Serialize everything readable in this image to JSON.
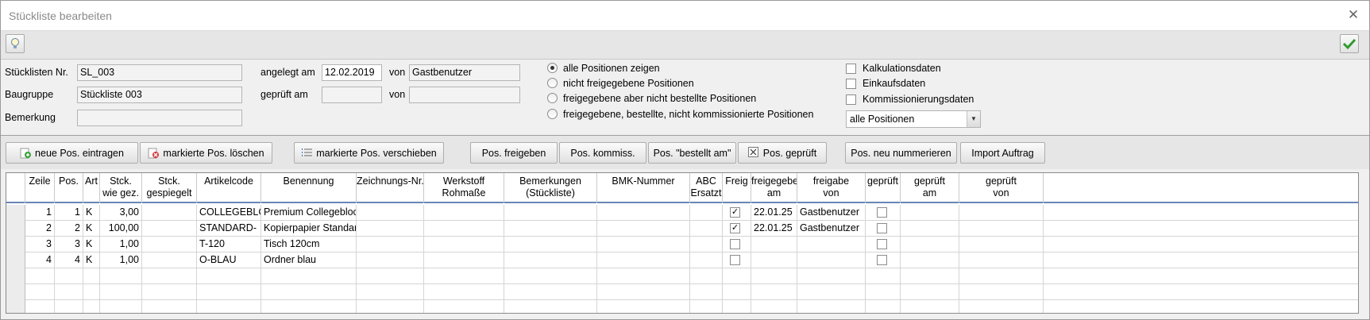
{
  "window": {
    "title": "Stückliste bearbeiten"
  },
  "header": {
    "stueckliste_label": "Stücklisten Nr.",
    "stueckliste_value": "SL_003",
    "baugruppe_label": "Baugruppe",
    "baugruppe_value": "Stückliste 003",
    "bemerkung_label": "Bemerkung",
    "bemerkung_value": "",
    "angelegt_label": "angelegt am",
    "angelegt_value": "12.02.2019",
    "von_label": "von",
    "angelegt_von_value": "Gastbenutzer",
    "geprueft_label": "geprüft am",
    "geprueft_value": "",
    "geprueft_von_value": ""
  },
  "filters": {
    "radios": [
      {
        "label": "alle Positionen zeigen",
        "selected": true
      },
      {
        "label": "nicht freigegebene Positionen",
        "selected": false
      },
      {
        "label": "freigegebene aber nicht bestellte Positionen",
        "selected": false
      },
      {
        "label": "freigegebene, bestellte, nicht kommissionierte Positionen",
        "selected": false
      }
    ],
    "checks": [
      {
        "label": "Kalkulationsdaten",
        "checked": false
      },
      {
        "label": "Einkaufsdaten",
        "checked": false
      },
      {
        "label": "Kommissionierungsdaten",
        "checked": false
      }
    ],
    "dropdown_value": "alle Positionen"
  },
  "buttons": {
    "neu": "neue Pos. eintragen",
    "loeschen": "markierte Pos. löschen",
    "verschieben": "markierte Pos. verschieben",
    "freigeben": "Pos. freigeben",
    "kommiss": "Pos. kommiss.",
    "bestellt": "Pos. \"bestellt am\"",
    "geprueft": "Pos. geprüft",
    "nummerieren": "Pos. neu nummerieren",
    "import": "Import Auftrag"
  },
  "grid": {
    "columns": [
      {
        "l1": "Zeile",
        "l2": ""
      },
      {
        "l1": "Pos.",
        "l2": ""
      },
      {
        "l1": "Art",
        "l2": ""
      },
      {
        "l1": "Stck.",
        "l2": "wie gez."
      },
      {
        "l1": "Stck.",
        "l2": "gespiegelt"
      },
      {
        "l1": "Artikelcode",
        "l2": ""
      },
      {
        "l1": "Benennung",
        "l2": ""
      },
      {
        "l1": "Zeichnungs-Nr.",
        "l2": ""
      },
      {
        "l1": "Werkstoff",
        "l2": "Rohmaße"
      },
      {
        "l1": "Bemerkungen",
        "l2": "(Stückliste)"
      },
      {
        "l1": "BMK-Nummer",
        "l2": ""
      },
      {
        "l1": "ABC",
        "l2": "Ersatzt"
      },
      {
        "l1": "Freig",
        "l2": ""
      },
      {
        "l1": "freigegebe",
        "l2": "am"
      },
      {
        "l1": "freigabe",
        "l2": "von"
      },
      {
        "l1": "geprüft",
        "l2": ""
      },
      {
        "l1": "geprüft",
        "l2": "am"
      },
      {
        "l1": "geprüft",
        "l2": "von"
      }
    ],
    "rows": [
      {
        "zeile": "1",
        "pos": "1",
        "art": "K",
        "stck": "3,00",
        "gesp": "",
        "code": "COLLEGEBLOCK",
        "ben": "Premium Collegeblock",
        "freig": true,
        "am": "22.01.25",
        "von": "Gastbenutzer",
        "gepr": false
      },
      {
        "zeile": "2",
        "pos": "2",
        "art": "K",
        "stck": "100,00",
        "gesp": "",
        "code": "STANDARD-",
        "ben": "Kopierpapier Standard",
        "freig": true,
        "am": "22.01.25",
        "von": "Gastbenutzer",
        "gepr": false
      },
      {
        "zeile": "3",
        "pos": "3",
        "art": "K",
        "stck": "1,00",
        "gesp": "",
        "code": "T-120",
        "ben": "Tisch 120cm",
        "freig": false,
        "am": "",
        "von": "",
        "gepr": false
      },
      {
        "zeile": "4",
        "pos": "4",
        "art": "K",
        "stck": "1,00",
        "gesp": "",
        "code": "O-BLAU",
        "ben": "Ordner blau",
        "freig": false,
        "am": "",
        "von": "",
        "gepr": false
      }
    ]
  }
}
